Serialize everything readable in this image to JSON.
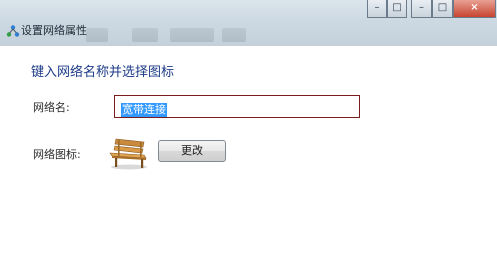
{
  "window": {
    "title": "设置网络属性"
  },
  "controls": {
    "minimize": "–",
    "maximize": "□",
    "close": "×",
    "minimize2": "–",
    "maximize2": "□"
  },
  "form": {
    "heading": "键入网络名称并选择图标",
    "name_label": "网络名:",
    "name_value": "宽带连接",
    "icon_label": "网络图标:",
    "icon_name": "bench-icon",
    "change_button": "更改"
  },
  "colors": {
    "heading": "#1d3b88",
    "selection": "#3399ff",
    "close_button": "#c7442f"
  }
}
